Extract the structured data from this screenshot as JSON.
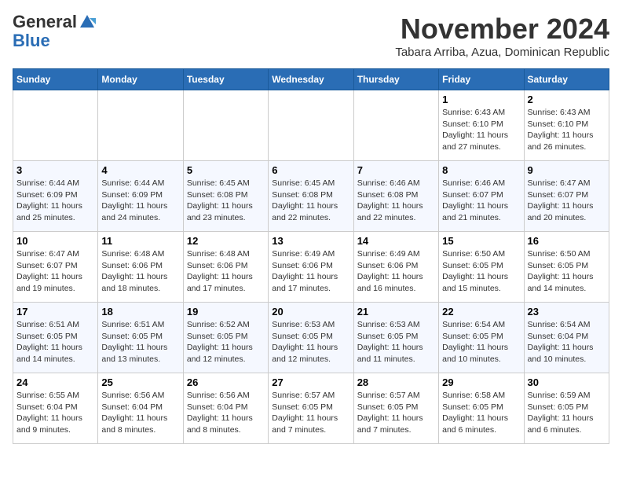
{
  "header": {
    "logo_general": "General",
    "logo_blue": "Blue",
    "month_title": "November 2024",
    "subtitle": "Tabara Arriba, Azua, Dominican Republic"
  },
  "days_of_week": [
    "Sunday",
    "Monday",
    "Tuesday",
    "Wednesday",
    "Thursday",
    "Friday",
    "Saturday"
  ],
  "weeks": [
    [
      {
        "day": "",
        "info": ""
      },
      {
        "day": "",
        "info": ""
      },
      {
        "day": "",
        "info": ""
      },
      {
        "day": "",
        "info": ""
      },
      {
        "day": "",
        "info": ""
      },
      {
        "day": "1",
        "info": "Sunrise: 6:43 AM\nSunset: 6:10 PM\nDaylight: 11 hours\nand 27 minutes."
      },
      {
        "day": "2",
        "info": "Sunrise: 6:43 AM\nSunset: 6:10 PM\nDaylight: 11 hours\nand 26 minutes."
      }
    ],
    [
      {
        "day": "3",
        "info": "Sunrise: 6:44 AM\nSunset: 6:09 PM\nDaylight: 11 hours\nand 25 minutes."
      },
      {
        "day": "4",
        "info": "Sunrise: 6:44 AM\nSunset: 6:09 PM\nDaylight: 11 hours\nand 24 minutes."
      },
      {
        "day": "5",
        "info": "Sunrise: 6:45 AM\nSunset: 6:08 PM\nDaylight: 11 hours\nand 23 minutes."
      },
      {
        "day": "6",
        "info": "Sunrise: 6:45 AM\nSunset: 6:08 PM\nDaylight: 11 hours\nand 22 minutes."
      },
      {
        "day": "7",
        "info": "Sunrise: 6:46 AM\nSunset: 6:08 PM\nDaylight: 11 hours\nand 22 minutes."
      },
      {
        "day": "8",
        "info": "Sunrise: 6:46 AM\nSunset: 6:07 PM\nDaylight: 11 hours\nand 21 minutes."
      },
      {
        "day": "9",
        "info": "Sunrise: 6:47 AM\nSunset: 6:07 PM\nDaylight: 11 hours\nand 20 minutes."
      }
    ],
    [
      {
        "day": "10",
        "info": "Sunrise: 6:47 AM\nSunset: 6:07 PM\nDaylight: 11 hours\nand 19 minutes."
      },
      {
        "day": "11",
        "info": "Sunrise: 6:48 AM\nSunset: 6:06 PM\nDaylight: 11 hours\nand 18 minutes."
      },
      {
        "day": "12",
        "info": "Sunrise: 6:48 AM\nSunset: 6:06 PM\nDaylight: 11 hours\nand 17 minutes."
      },
      {
        "day": "13",
        "info": "Sunrise: 6:49 AM\nSunset: 6:06 PM\nDaylight: 11 hours\nand 17 minutes."
      },
      {
        "day": "14",
        "info": "Sunrise: 6:49 AM\nSunset: 6:06 PM\nDaylight: 11 hours\nand 16 minutes."
      },
      {
        "day": "15",
        "info": "Sunrise: 6:50 AM\nSunset: 6:05 PM\nDaylight: 11 hours\nand 15 minutes."
      },
      {
        "day": "16",
        "info": "Sunrise: 6:50 AM\nSunset: 6:05 PM\nDaylight: 11 hours\nand 14 minutes."
      }
    ],
    [
      {
        "day": "17",
        "info": "Sunrise: 6:51 AM\nSunset: 6:05 PM\nDaylight: 11 hours\nand 14 minutes."
      },
      {
        "day": "18",
        "info": "Sunrise: 6:51 AM\nSunset: 6:05 PM\nDaylight: 11 hours\nand 13 minutes."
      },
      {
        "day": "19",
        "info": "Sunrise: 6:52 AM\nSunset: 6:05 PM\nDaylight: 11 hours\nand 12 minutes."
      },
      {
        "day": "20",
        "info": "Sunrise: 6:53 AM\nSunset: 6:05 PM\nDaylight: 11 hours\nand 12 minutes."
      },
      {
        "day": "21",
        "info": "Sunrise: 6:53 AM\nSunset: 6:05 PM\nDaylight: 11 hours\nand 11 minutes."
      },
      {
        "day": "22",
        "info": "Sunrise: 6:54 AM\nSunset: 6:05 PM\nDaylight: 11 hours\nand 10 minutes."
      },
      {
        "day": "23",
        "info": "Sunrise: 6:54 AM\nSunset: 6:04 PM\nDaylight: 11 hours\nand 10 minutes."
      }
    ],
    [
      {
        "day": "24",
        "info": "Sunrise: 6:55 AM\nSunset: 6:04 PM\nDaylight: 11 hours\nand 9 minutes."
      },
      {
        "day": "25",
        "info": "Sunrise: 6:56 AM\nSunset: 6:04 PM\nDaylight: 11 hours\nand 8 minutes."
      },
      {
        "day": "26",
        "info": "Sunrise: 6:56 AM\nSunset: 6:04 PM\nDaylight: 11 hours\nand 8 minutes."
      },
      {
        "day": "27",
        "info": "Sunrise: 6:57 AM\nSunset: 6:05 PM\nDaylight: 11 hours\nand 7 minutes."
      },
      {
        "day": "28",
        "info": "Sunrise: 6:57 AM\nSunset: 6:05 PM\nDaylight: 11 hours\nand 7 minutes."
      },
      {
        "day": "29",
        "info": "Sunrise: 6:58 AM\nSunset: 6:05 PM\nDaylight: 11 hours\nand 6 minutes."
      },
      {
        "day": "30",
        "info": "Sunrise: 6:59 AM\nSunset: 6:05 PM\nDaylight: 11 hours\nand 6 minutes."
      }
    ]
  ]
}
